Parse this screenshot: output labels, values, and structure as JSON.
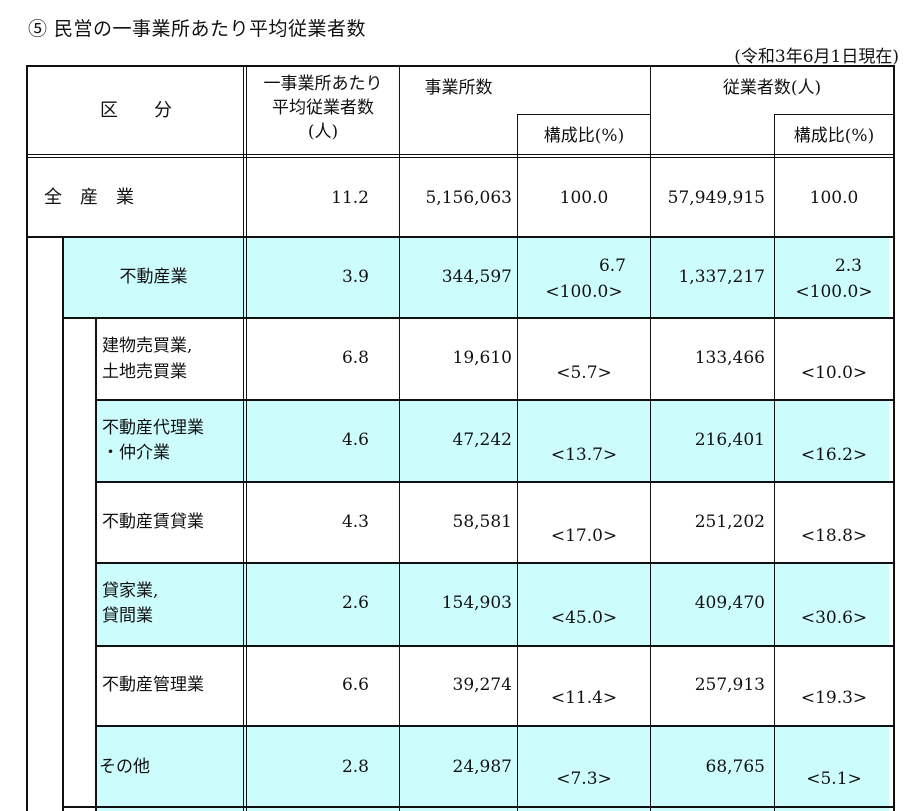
{
  "title": "⑤ 民営の一事業所あたり平均従業者数",
  "date_note": "(令和3年6月1日現在)",
  "header": {
    "category": "区　　分",
    "avg_employees": [
      "一事業所あたり",
      "平均従業者数",
      "(人)"
    ],
    "establishments": "事業所数",
    "employees": "従業者数(人)",
    "ratio1": "構成比(%)",
    "ratio2": "構成比(%)"
  },
  "rows": [
    {
      "label": [
        "全　産　業"
      ],
      "avg": "11.2",
      "estab": "5,156,063",
      "ratio1": [
        "100.0"
      ],
      "emp": "57,949,915",
      "ratio2": [
        "100.0"
      ]
    },
    {
      "label": [
        "不動産業"
      ],
      "avg": "3.9",
      "estab": "344,597",
      "ratio1": [
        "6.7",
        "<100.0>"
      ],
      "emp": "1,337,217",
      "ratio2": [
        "2.3",
        "<100.0>"
      ]
    },
    {
      "label": [
        "建物売買業,",
        "土地売買業"
      ],
      "avg": "6.8",
      "estab": "19,610",
      "ratio1": [
        "<5.7>"
      ],
      "emp": "133,466",
      "ratio2": [
        "<10.0>"
      ]
    },
    {
      "label": [
        "不動産代理業",
        "・仲介業"
      ],
      "avg": "4.6",
      "estab": "47,242",
      "ratio1": [
        "<13.7>"
      ],
      "emp": "216,401",
      "ratio2": [
        "<16.2>"
      ]
    },
    {
      "label": [
        "不動産賃貸業"
      ],
      "avg": "4.3",
      "estab": "58,581",
      "ratio1": [
        "<17.0>"
      ],
      "emp": "251,202",
      "ratio2": [
        "<18.8>"
      ]
    },
    {
      "label": [
        "貸家業,",
        "貸間業"
      ],
      "avg": "2.6",
      "estab": "154,903",
      "ratio1": [
        "<45.0>"
      ],
      "emp": "409,470",
      "ratio2": [
        "<30.6>"
      ]
    },
    {
      "label": [
        "不動産管理業"
      ],
      "avg": "6.6",
      "estab": "39,274",
      "ratio1": [
        "<11.4>"
      ],
      "emp": "257,913",
      "ratio2": [
        "<19.3>"
      ]
    },
    {
      "label": [
        "その他"
      ],
      "avg": "2.8",
      "estab": "24,987",
      "ratio1": [
        "<7.3>"
      ],
      "emp": "68,765",
      "ratio2": [
        "<5.1>"
      ]
    }
  ],
  "colors": {
    "highlight": "#cdfcfd",
    "rule": "#111111"
  }
}
